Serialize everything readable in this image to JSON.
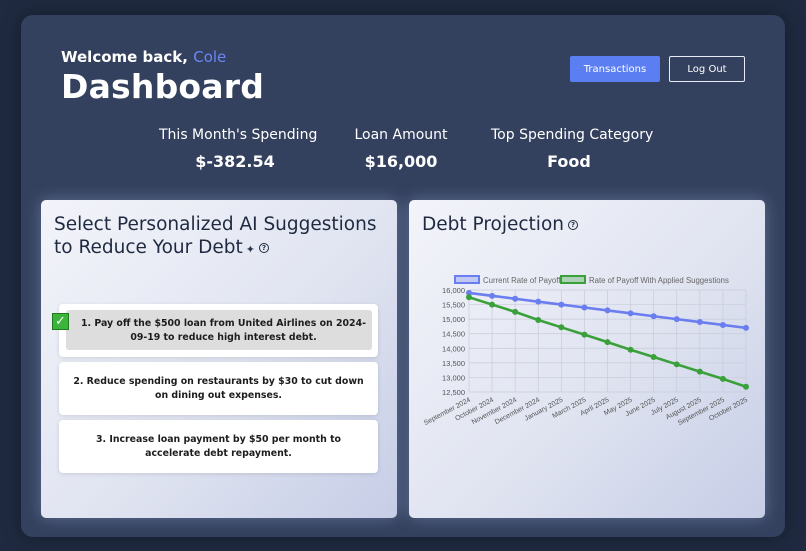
{
  "header": {
    "welcome": "Welcome back,",
    "user_name": "Cole",
    "title": "Dashboard",
    "transactions_label": "Transactions",
    "logout_label": "Log Out"
  },
  "stats": [
    {
      "label": "This Month's Spending",
      "value": "$-382.54"
    },
    {
      "label": "Loan Amount",
      "value": "$16,000"
    },
    {
      "label": "Top Spending Category",
      "value": "Food"
    }
  ],
  "suggestions": {
    "title_line1": "Select Personalized AI Suggestions",
    "title_line2": "to Reduce Your Debt",
    "sparkle_icon": "sparkle-icon",
    "help_icon": "question-circle-icon",
    "items": [
      {
        "text": "1. Pay off the $500 loan from United Airlines on 2024-09-19 to reduce high interest debt.",
        "selected": true
      },
      {
        "text": "2. Reduce spending on restaurants by $30 to cut down on dining out expenses.",
        "selected": false
      },
      {
        "text": "3. Increase loan payment by $50 per month to accelerate debt repayment.",
        "selected": false
      }
    ]
  },
  "projection": {
    "title": "Debt Projection",
    "help_icon": "question-circle-icon"
  },
  "chart_data": {
    "type": "line",
    "categories": [
      "September 2024",
      "October 2024",
      "November 2024",
      "December 2024",
      "January 2025",
      "February 2025",
      "March 2025",
      "April 2025",
      "May 2025",
      "June 2025",
      "July 2025",
      "August 2025",
      "September 2025",
      "October 2025"
    ],
    "x_tick_labels": [
      "September 2024",
      "October 2024",
      "November 2024",
      "December 2024",
      "January 2025",
      "March 2025",
      "April 2025",
      "May 2025",
      "June 2025",
      "July 2025",
      "August 2025",
      "September 2025",
      "October 2025"
    ],
    "series": [
      {
        "name": "Current Rate of Payoff",
        "color": "#6b7ef0",
        "values": [
          15900,
          15800,
          15700,
          15600,
          15500,
          15400,
          15300,
          15200,
          15100,
          15000,
          14900,
          14800,
          14700
        ]
      },
      {
        "name": "Rate of Payoff With Applied Suggestions",
        "color": "#3aa03a",
        "values": [
          15750,
          15500,
          15250,
          14970,
          14720,
          14470,
          14210,
          13950,
          13700,
          13450,
          13200,
          12950,
          12680
        ]
      }
    ],
    "y_ticks": [
      "16,000",
      "15,500",
      "15,000",
      "14,500",
      "14,000",
      "13,500",
      "13,000",
      "12,500"
    ],
    "ylim": [
      12500,
      16000
    ],
    "grid": true,
    "legend_position": "top"
  },
  "colors": {
    "accent": "#5b7ff2",
    "background": "#1f2a40",
    "card_bg": "#34415e"
  }
}
